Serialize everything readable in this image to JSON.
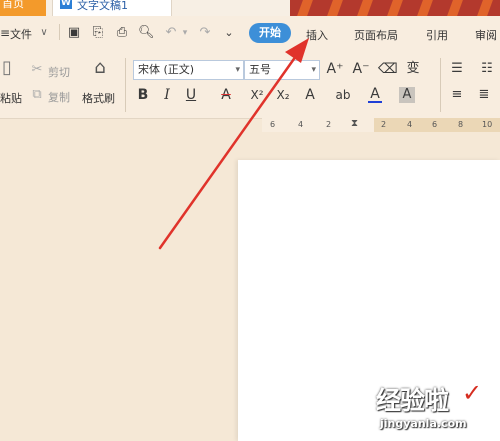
{
  "tabs": {
    "home_label": "首页",
    "doc_icon": "W",
    "doc_title": "文字文稿1"
  },
  "menu": {
    "file_label": "文件",
    "items": [
      "开始",
      "插入",
      "页面布局",
      "引用",
      "审阅"
    ],
    "active_color": "#3d8fd8"
  },
  "ribbon": {
    "paste_label": "粘贴",
    "cut_label": "剪切",
    "copy_label": "复制",
    "format_painter_label": "格式刷",
    "font_name": "宋体 (正文)",
    "font_size": "五号",
    "grow_font": "A⁺",
    "shrink_font": "A⁻",
    "phonetic_glyph": "变",
    "bold": "B",
    "italic": "I",
    "underline": "U",
    "strikethrough": "A",
    "superscript": "X²",
    "subscript": "X₂",
    "text_effect": "A",
    "highlight": "ab",
    "font_color": "A",
    "char_shading": "A"
  },
  "ruler": {
    "marks": [
      "6",
      "4",
      "2",
      "2",
      "4",
      "6",
      "8",
      "10"
    ]
  },
  "watermark": {
    "brand": "经验啦",
    "url": "jingyanla.com"
  },
  "colors": {
    "annotation_arrow": "#e0332b",
    "brand_orange": "#f39a2b",
    "banner_red": "#b3392d"
  }
}
